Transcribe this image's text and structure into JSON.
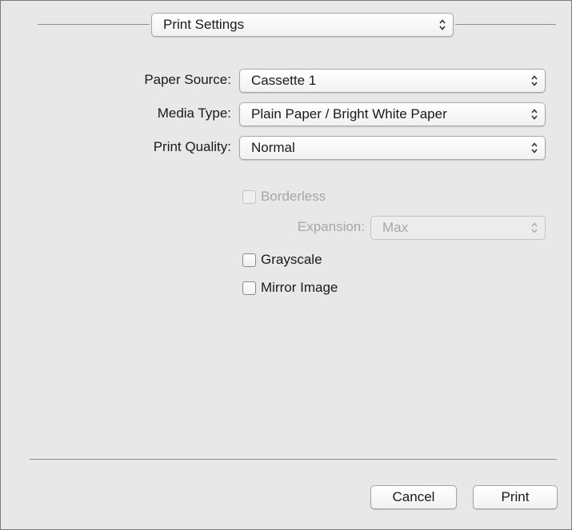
{
  "panel_selector": {
    "value": "Print Settings"
  },
  "fields": {
    "paper_source": {
      "label": "Paper Source:",
      "value": "Cassette 1"
    },
    "media_type": {
      "label": "Media Type:",
      "value": "Plain Paper / Bright White Paper"
    },
    "print_quality": {
      "label": "Print Quality:",
      "value": "Normal"
    }
  },
  "options": {
    "borderless": {
      "label": "Borderless",
      "checked": false,
      "enabled": false
    },
    "expansion": {
      "label": "Expansion:",
      "value": "Max",
      "enabled": false
    },
    "grayscale": {
      "label": "Grayscale",
      "checked": false,
      "enabled": true
    },
    "mirror_image": {
      "label": "Mirror Image",
      "checked": false,
      "enabled": true
    }
  },
  "buttons": {
    "cancel": "Cancel",
    "print": "Print"
  },
  "icons": {
    "popup_indicator": "up-down-chevron-icon"
  },
  "colors": {
    "dialog_background": "#e8e8e8",
    "disabled_text": "#a6a6a6"
  }
}
